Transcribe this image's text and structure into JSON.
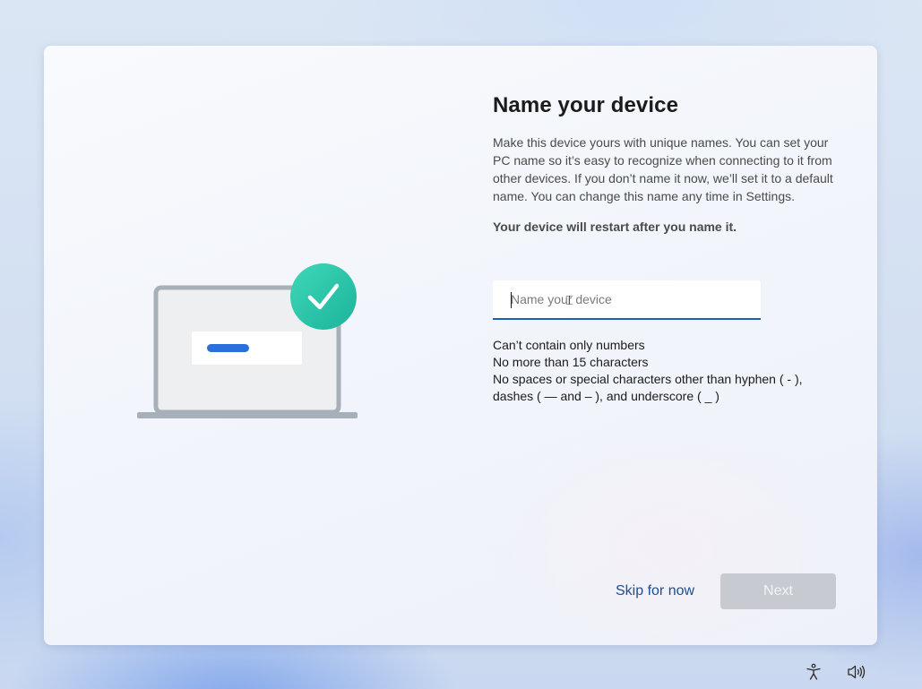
{
  "setup": {
    "title": "Name your device",
    "description": "Make this device yours with unique names. You can set your PC name so it’s easy to recognize when connecting to it from other devices. If you don’t name it now, we’ll set it to a default name. You can change this name any time in Settings.",
    "restart_note": "Your device will restart after you name it.",
    "device_name": {
      "value": "",
      "placeholder": "Name your device"
    },
    "rules": [
      "Can’t contain only numbers",
      "No more than 15 characters",
      "No spaces or special characters other than hyphen ( - ), dashes ( — and – ), and underscore ( _ )"
    ],
    "skip_label": "Skip for now",
    "next_label": "Next"
  },
  "illustration": {
    "description_icons": [
      "laptop-icon",
      "checkmark-badge-icon"
    ],
    "accent_color": "#2bc5a5",
    "bar_color": "#2a6fdb"
  },
  "taskbar": {
    "icons": [
      "accessibility-icon",
      "volume-icon"
    ]
  },
  "colors": {
    "input_underline": "#1a5fb4",
    "link": "#1d4e8f",
    "disabled_button": "#c7cbd1"
  }
}
